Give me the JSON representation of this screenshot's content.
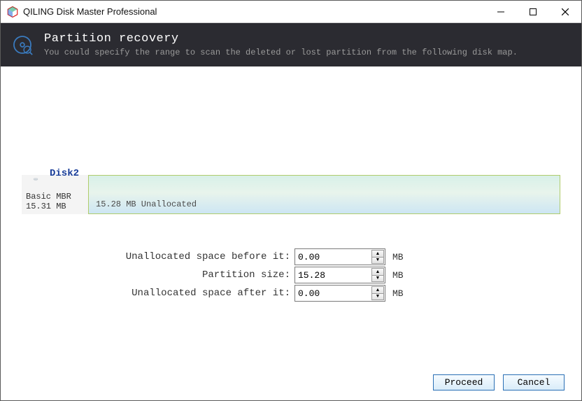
{
  "window": {
    "title": "QILING Disk Master Professional"
  },
  "header": {
    "title": "Partition recovery",
    "subtitle": "You could specify the range to scan the deleted or lost partition from the following disk map."
  },
  "disk": {
    "name": "Disk2",
    "type": "Basic MBR",
    "size": "15.31 MB",
    "partition_label": "15.28 MB Unallocated"
  },
  "form": {
    "before": {
      "label": "Unallocated space before it:",
      "value": "0.00",
      "unit": "MB"
    },
    "size": {
      "label": "Partition size:",
      "value": "15.28",
      "unit": "MB"
    },
    "after": {
      "label": "Unallocated space after it:",
      "value": "0.00",
      "unit": "MB"
    }
  },
  "buttons": {
    "proceed": "Proceed",
    "cancel": "Cancel"
  }
}
